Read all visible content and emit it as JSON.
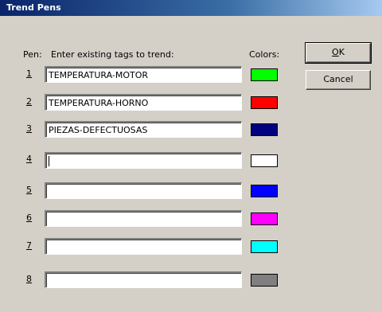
{
  "window": {
    "title": "Trend Pens"
  },
  "header": {
    "pen_label": "Pen:",
    "instructions": "Enter existing tags to trend:",
    "colors_label": "Colors:"
  },
  "buttons": {
    "ok": "OK",
    "cancel": "Cancel"
  },
  "pens": [
    {
      "number": "1",
      "tag": "TEMPERATURA-MOTOR",
      "color": "#00ff00"
    },
    {
      "number": "2",
      "tag": "TEMPERATURA-HORNO",
      "color": "#ff0000"
    },
    {
      "number": "3",
      "tag": "PIEZAS-DEFECTUOSAS",
      "color": "#000080"
    },
    {
      "number": "4",
      "tag": "",
      "color": "#ffffff"
    },
    {
      "number": "5",
      "tag": "",
      "color": "#0000ff"
    },
    {
      "number": "6",
      "tag": "",
      "color": "#ff00ff"
    },
    {
      "number": "7",
      "tag": "",
      "color": "#00ffff"
    },
    {
      "number": "8",
      "tag": "",
      "color": "#808080"
    }
  ]
}
